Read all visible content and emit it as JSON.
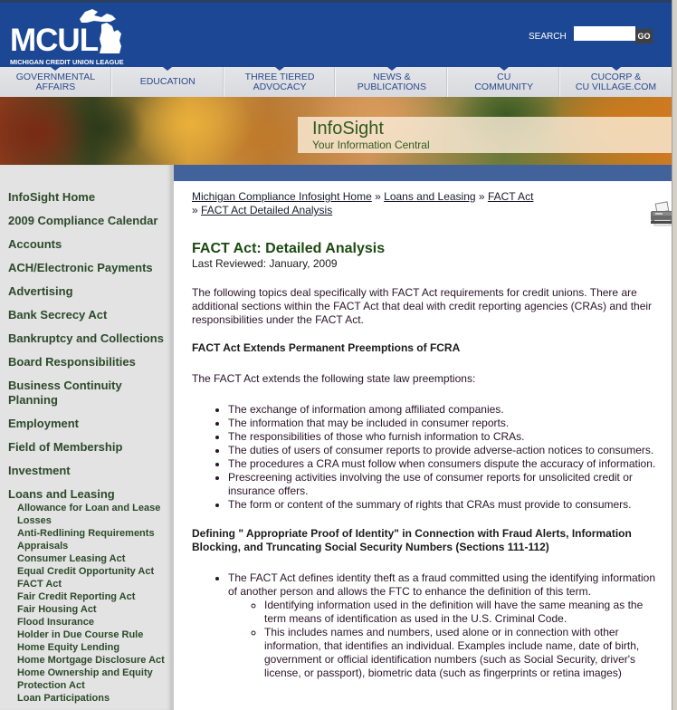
{
  "header": {
    "logo_text": "MCUL",
    "logo_subtitle": "MICHIGAN CREDIT UNION LEAGUE",
    "search_label": "SEARCH",
    "search_value": "",
    "search_button": "GO"
  },
  "nav": [
    {
      "line1": "GOVERNMENTAL",
      "line2": "AFFAIRS"
    },
    {
      "line1": "EDUCATION",
      "line2": ""
    },
    {
      "line1": "THREE TIERED",
      "line2": "ADVOCACY"
    },
    {
      "line1": "NEWS &",
      "line2": "PUBLICATIONS"
    },
    {
      "line1": "CU",
      "line2": "COMMUNITY"
    },
    {
      "line1": "CUCORP &",
      "line2": "CU VILLAGE.COM"
    }
  ],
  "banner": {
    "title": "InfoSight",
    "subtitle": "Your Information Central"
  },
  "sidebar": {
    "items": [
      "InfoSight Home",
      "2009 Compliance Calendar",
      "Accounts",
      "ACH/Electronic Payments",
      "Advertising",
      "Bank Secrecy Act",
      "Bankruptcy and Collections",
      "Board Responsibilities",
      "Business Continuity Planning",
      "Employment",
      "Field of Membership",
      "Investment"
    ],
    "group_title": "Loans and Leasing",
    "sub_items": [
      "Allowance for Loan and Lease Losses",
      "Anti-Redlining Requirements",
      "Appraisals",
      "Consumer Leasing Act",
      "Equal Credit Opportunity Act",
      "FACT Act",
      "Fair Credit Reporting Act",
      "Fair Housing Act",
      "Flood Insurance",
      "Holder in Due Course Rule",
      "Home Equity Lending",
      "Home Mortgage Disclosure Act",
      "Home Ownership and Equity Protection Act",
      "Loan Participations"
    ]
  },
  "breadcrumb": {
    "items": [
      "Michigan Compliance Infosight Home",
      "Loans and Leasing",
      "FACT Act",
      "FACT Act Detailed Analysis"
    ],
    "separator": "»"
  },
  "article": {
    "title": "FACT Act: Detailed Analysis",
    "last_reviewed": "Last Reviewed: January, 2009",
    "intro": "The following topics deal specifically with FACT Act requirements for credit unions.  There are additional sections within the FACT Act that deal with credit reporting agencies (CRAs) and their responsibilities under the FACT Act.",
    "section1_heading": "FACT Act Extends Permanent Preemptions of FCRA",
    "section1_lead": "The FACT Act extends the following state law preemptions:",
    "section1_bullets": [
      "The exchange of information among affiliated companies.",
      "The information that may be included in consumer reports.",
      "The responsibilities of those who furnish information to CRAs.",
      "The duties of users of consumer reports to provide adverse-action notices to consumers.",
      "The procedures a CRA must follow when consumers dispute the accuracy of information.",
      "Prescreening activities involving the use of consumer reports for unsolicited credit or insurance offers.",
      "The form or content of the summary of rights that CRAs must provide to consumers."
    ],
    "section2_heading": "Defining \" Appropriate Proof of Identity\" in Connection with Fraud Alerts, Information Blocking, and Truncating Social Security Numbers (Sections 111-112)",
    "section2_bullet": "The FACT Act defines identity theft as a fraud committed using the identifying information of another person and allows the FTC to enhance the definition of this term.",
    "section2_subbullets": [
      "Identifying information used in the definition will have the same meaning as the term means of identification as used in the U.S. Criminal Code.",
      "This includes names and numbers, used alone or in connection with other information, that identifies an individual.  Examples include name, date of birth, government or official identification numbers (such as Social Security, driver's license, or passport), biometric data (such as fingerprints or retina images)"
    ]
  },
  "colors": {
    "header_blue": "#1c4794",
    "nav_text": "#2b4a8a",
    "sidebar_text": "#2c4a2a",
    "title_green": "#1d4a12",
    "main_bar": "#41629a"
  }
}
